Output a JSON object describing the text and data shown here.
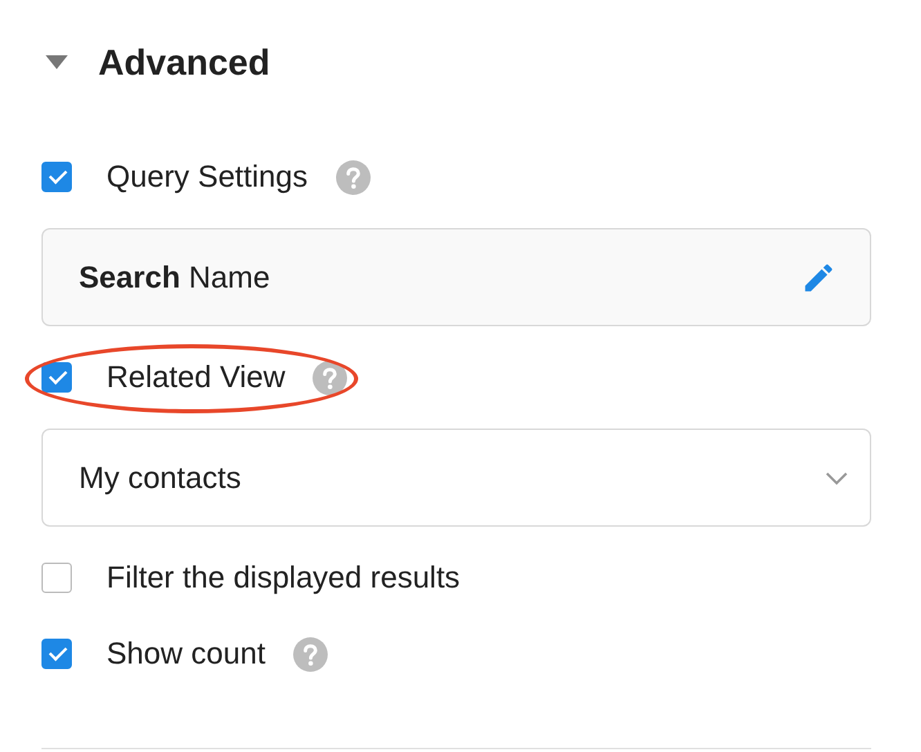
{
  "section": {
    "title": "Advanced",
    "expanded": true
  },
  "items": [
    {
      "kind": "checkbox",
      "label": "Query Settings",
      "checked": true,
      "help": true,
      "highlighted": false
    },
    {
      "kind": "name-field",
      "value": "**Search** Name"
    },
    {
      "kind": "checkbox",
      "label": "Related View",
      "checked": true,
      "help": true,
      "highlighted": true
    },
    {
      "kind": "select",
      "value": "My contacts"
    },
    {
      "kind": "checkbox",
      "label": "Filter the displayed results",
      "checked": false,
      "help": false,
      "highlighted": false
    },
    {
      "kind": "checkbox",
      "label": "Show count",
      "checked": true,
      "help": true,
      "highlighted": false
    }
  ]
}
